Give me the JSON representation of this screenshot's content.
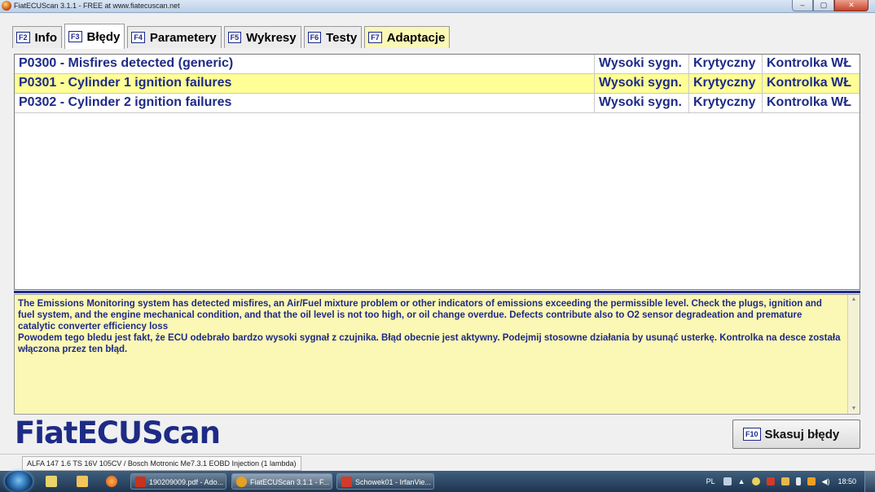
{
  "window": {
    "title": "FiatECUScan 3.1.1 - FREE at www.fiatecuscan.net"
  },
  "tabs": [
    {
      "key": "F2",
      "label": "Info",
      "active": false
    },
    {
      "key": "F3",
      "label": "Błędy",
      "active": true
    },
    {
      "key": "F4",
      "label": "Parametery",
      "active": false
    },
    {
      "key": "F5",
      "label": "Wykresy",
      "active": false
    },
    {
      "key": "F6",
      "label": "Testy",
      "active": false
    },
    {
      "key": "F7",
      "label": "Adaptacje",
      "active": false
    }
  ],
  "errors": [
    {
      "code_desc": "P0300 - Misfires detected (generic)",
      "signal": "Wysoki sygn.",
      "severity": "Krytyczny",
      "lamp": "Kontrolka WŁ",
      "selected": false
    },
    {
      "code_desc": "P0301 - Cylinder 1 ignition failures",
      "signal": "Wysoki sygn.",
      "severity": "Krytyczny",
      "lamp": "Kontrolka WŁ",
      "selected": true
    },
    {
      "code_desc": "P0302 - Cylinder 2 ignition failures",
      "signal": "Wysoki sygn.",
      "severity": "Krytyczny",
      "lamp": "Kontrolka WŁ",
      "selected": false
    }
  ],
  "description": {
    "english": "The Emissions Monitoring system has detected misfires, an Air/Fuel mixture problem or other indicators of emissions exceeding the permissible level. Check the plugs, ignition and fuel system, and the engine mechanical condition, and that the oil level is not too high, or oil change overdue. Defects contribute also to O2 sensor degradeation and premature catalytic converter efficiency loss",
    "polish": "Powodem tego bledu jest fakt, że ECU odebrało bardzo wysoki sygnał z czujnika. Błąd obecnie jest aktywny. Podejmij stosowne działania by usunąć usterkę. Kontrolka na desce została włączona przez ten błąd."
  },
  "logo": "FiatECUScan",
  "clear_button": {
    "key": "F10",
    "label": "Skasuj błędy"
  },
  "status": {
    "vehicle": "ALFA 147 1.6 TS 16V 105CV / Bosch Motronic Me7.3.1 EOBD Injection (1 lambda)"
  },
  "taskbar": {
    "tasks": [
      {
        "label": "190209009.pdf - Ado...",
        "color": "#c8321e"
      },
      {
        "label": "FiatECUScan 3.1.1 - F...",
        "color": "#e8a020"
      },
      {
        "label": "Schowek01 - IrfanVie...",
        "color": "#d23a2a"
      }
    ],
    "lang": "PL",
    "clock": "18:50"
  },
  "colors": {
    "accent": "#1e2b86",
    "highlight": "#ffff96",
    "description_bg": "#fbf7b4"
  }
}
